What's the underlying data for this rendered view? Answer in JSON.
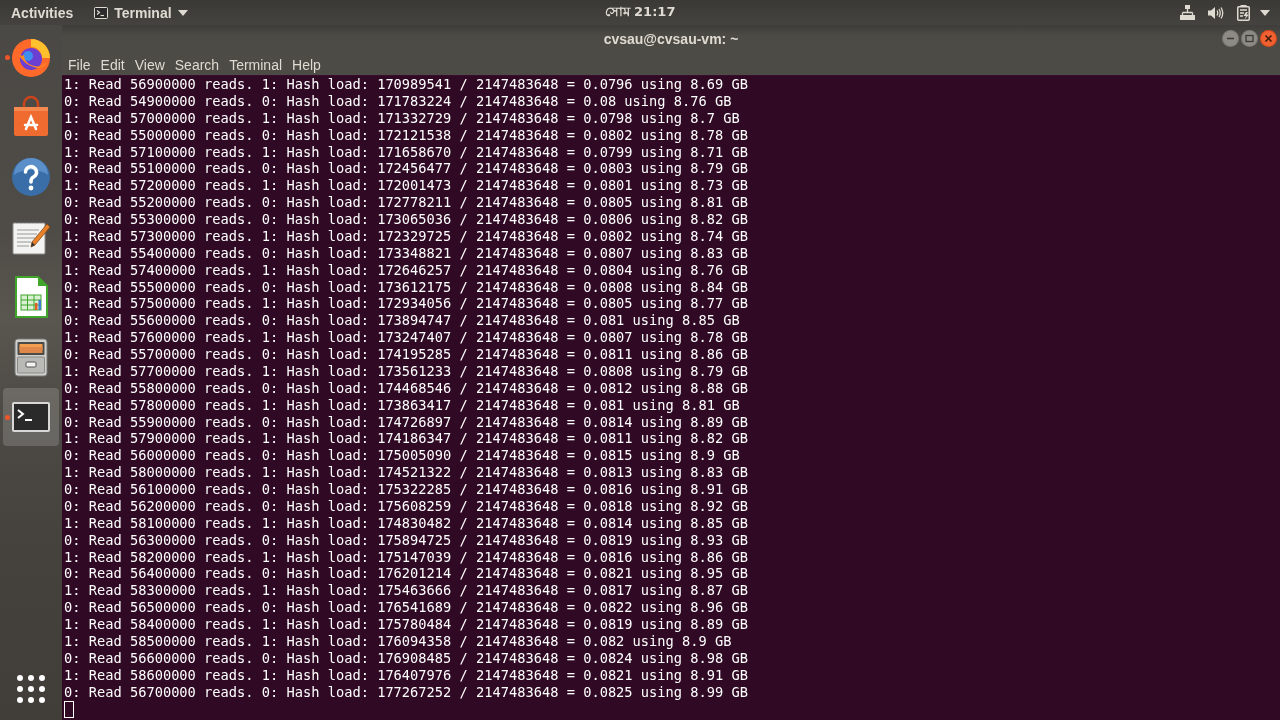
{
  "top_bar": {
    "activities": "Activities",
    "app_menu": "Terminal",
    "clock": "সোম 21:17"
  },
  "dock": {
    "items": [
      {
        "kind": "browser",
        "running": true,
        "selected": false
      },
      {
        "kind": "store",
        "running": false,
        "selected": false
      },
      {
        "kind": "help",
        "running": false,
        "selected": false
      },
      {
        "kind": "editor",
        "running": false,
        "selected": false
      },
      {
        "kind": "spreadsheet",
        "running": false,
        "selected": false
      },
      {
        "kind": "files",
        "running": false,
        "selected": false
      },
      {
        "kind": "terminal",
        "running": true,
        "selected": true
      }
    ]
  },
  "window": {
    "title": "cvsau@cvsau-vm: ~",
    "menu": [
      "File",
      "Edit",
      "View",
      "Search",
      "Terminal",
      "Help"
    ],
    "terminal": {
      "lines": [
        "1: Read 56900000 reads. 1: Hash load: 170989541 / 2147483648 = 0.0796 using 8.69 GB",
        "0: Read 54900000 reads. 0: Hash load: 171783224 / 2147483648 = 0.08 using 8.76 GB",
        "1: Read 57000000 reads. 1: Hash load: 171332729 / 2147483648 = 0.0798 using 8.7 GB",
        "0: Read 55000000 reads. 0: Hash load: 172121538 / 2147483648 = 0.0802 using 8.78 GB",
        "1: Read 57100000 reads. 1: Hash load: 171658670 / 2147483648 = 0.0799 using 8.71 GB",
        "0: Read 55100000 reads. 0: Hash load: 172456477 / 2147483648 = 0.0803 using 8.79 GB",
        "1: Read 57200000 reads. 1: Hash load: 172001473 / 2147483648 = 0.0801 using 8.73 GB",
        "0: Read 55200000 reads. 0: Hash load: 172778211 / 2147483648 = 0.0805 using 8.81 GB",
        "0: Read 55300000 reads. 0: Hash load: 173065036 / 2147483648 = 0.0806 using 8.82 GB",
        "1: Read 57300000 reads. 1: Hash load: 172329725 / 2147483648 = 0.0802 using 8.74 GB",
        "0: Read 55400000 reads. 0: Hash load: 173348821 / 2147483648 = 0.0807 using 8.83 GB",
        "1: Read 57400000 reads. 1: Hash load: 172646257 / 2147483648 = 0.0804 using 8.76 GB",
        "0: Read 55500000 reads. 0: Hash load: 173612175 / 2147483648 = 0.0808 using 8.84 GB",
        "1: Read 57500000 reads. 1: Hash load: 172934056 / 2147483648 = 0.0805 using 8.77 GB",
        "0: Read 55600000 reads. 0: Hash load: 173894747 / 2147483648 = 0.081 using 8.85 GB",
        "1: Read 57600000 reads. 1: Hash load: 173247407 / 2147483648 = 0.0807 using 8.78 GB",
        "0: Read 55700000 reads. 0: Hash load: 174195285 / 2147483648 = 0.0811 using 8.86 GB",
        "1: Read 57700000 reads. 1: Hash load: 173561233 / 2147483648 = 0.0808 using 8.79 GB",
        "0: Read 55800000 reads. 0: Hash load: 174468546 / 2147483648 = 0.0812 using 8.88 GB",
        "1: Read 57800000 reads. 1: Hash load: 173863417 / 2147483648 = 0.081 using 8.81 GB",
        "0: Read 55900000 reads. 0: Hash load: 174726897 / 2147483648 = 0.0814 using 8.89 GB",
        "1: Read 57900000 reads. 1: Hash load: 174186347 / 2147483648 = 0.0811 using 8.82 GB",
        "0: Read 56000000 reads. 0: Hash load: 175005090 / 2147483648 = 0.0815 using 8.9 GB",
        "1: Read 58000000 reads. 1: Hash load: 174521322 / 2147483648 = 0.0813 using 8.83 GB",
        "0: Read 56100000 reads. 0: Hash load: 175322285 / 2147483648 = 0.0816 using 8.91 GB",
        "0: Read 56200000 reads. 0: Hash load: 175608259 / 2147483648 = 0.0818 using 8.92 GB",
        "1: Read 58100000 reads. 1: Hash load: 174830482 / 2147483648 = 0.0814 using 8.85 GB",
        "0: Read 56300000 reads. 0: Hash load: 175894725 / 2147483648 = 0.0819 using 8.93 GB",
        "1: Read 58200000 reads. 1: Hash load: 175147039 / 2147483648 = 0.0816 using 8.86 GB",
        "0: Read 56400000 reads. 0: Hash load: 176201214 / 2147483648 = 0.0821 using 8.95 GB",
        "1: Read 58300000 reads. 1: Hash load: 175463666 / 2147483648 = 0.0817 using 8.87 GB",
        "0: Read 56500000 reads. 0: Hash load: 176541689 / 2147483648 = 0.0822 using 8.96 GB",
        "1: Read 58400000 reads. 1: Hash load: 175780484 / 2147483648 = 0.0819 using 8.89 GB",
        "1: Read 58500000 reads. 1: Hash load: 176094358 / 2147483648 = 0.082 using 8.9 GB",
        "0: Read 56600000 reads. 0: Hash load: 176908485 / 2147483648 = 0.0824 using 8.98 GB",
        "1: Read 58600000 reads. 1: Hash load: 176407976 / 2147483648 = 0.0821 using 8.91 GB",
        "0: Read 56700000 reads. 0: Hash load: 177267252 / 2147483648 = 0.0825 using 8.99 GB"
      ]
    }
  }
}
